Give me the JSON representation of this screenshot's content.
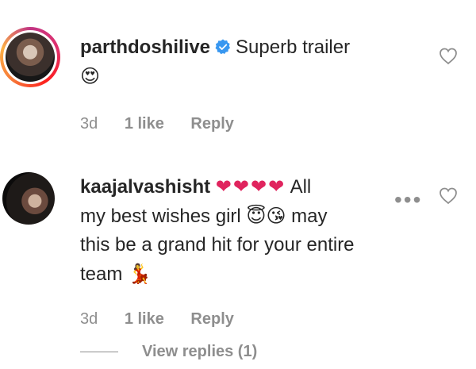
{
  "comments": [
    {
      "username": "parthdoshilive",
      "verified": true,
      "text_line1": "Superb trailer",
      "text_line2_emoji": "😍",
      "time": "3d",
      "likes": "1 like",
      "reply": "Reply"
    },
    {
      "username": "kaajalvashisht",
      "verified": false,
      "hearts": "❤❤❤❤",
      "text_line1": "All",
      "text_line2": "my best wishes girl",
      "emoji_a": "😇",
      "emoji_b": "😘",
      "text_line2b": "may",
      "text_line3": "this be a grand hit for your entire",
      "text_line4": "team",
      "emoji_c": "💃",
      "time": "3d",
      "likes": "1 like",
      "reply": "Reply",
      "more": "•••",
      "view_replies": "View replies (1)"
    }
  ],
  "icons": {
    "verified": "verified-badge-icon",
    "like": "heart-outline-icon",
    "more": "more-options-icon"
  },
  "colors": {
    "text": "#262626",
    "muted": "#8e8e8e",
    "verified": "#3897f0",
    "hearts": "#e0245e"
  }
}
